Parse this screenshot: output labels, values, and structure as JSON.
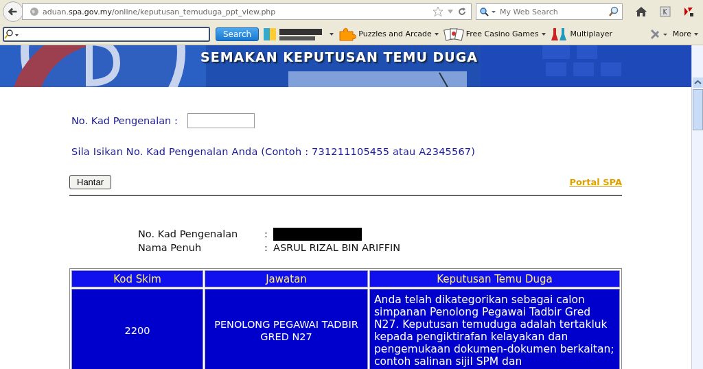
{
  "browser": {
    "address": {
      "host_prefix": "aduan.",
      "host_main": "spa.gov.my",
      "path": "/online/keputusan_temuduga_ppt_view.php"
    },
    "web_search": {
      "placeholder": "My Web Search"
    },
    "toolbar": {
      "search_button": "Search",
      "items": [
        {
          "label": "Puzzles and Arcade",
          "dropdown": true
        },
        {
          "label": "Free Casino Games",
          "dropdown": true
        },
        {
          "label": "Multiplayer",
          "dropdown": false
        }
      ],
      "more": "More"
    }
  },
  "banner": {
    "title": "SEMAKAN KEPUTUSAN TEMU DUGA"
  },
  "form": {
    "id_label": "No. Kad Pengenalan :",
    "hint": "Sila Isikan No. Kad Pengenalan Anda (Contoh : 731211105455 atau A2345567)",
    "submit": "Hantar",
    "portal_link": "Portal SPA"
  },
  "result": {
    "fields": [
      {
        "label": "No. Kad Pengenalan",
        "separator": ":",
        "redacted": true
      },
      {
        "label": "Nama Penuh",
        "separator": ":",
        "value": "ASRUL RIZAL BIN ARIFFIN",
        "redacted": false
      }
    ],
    "table": {
      "columns": [
        "Kod Skim",
        "Jawatan",
        "Keputusan Temu Duga"
      ],
      "rows": [
        {
          "cells": [
            "2200",
            "PENOLONG PEGAWAI TADBIR GRED N27",
            "Anda telah dikategorikan sebagai calon simpanan Penolong Pegawai Tadbir Gred N27. Keputusan temuduga adalah tertakluk kepada pengiktirafan kelayakan dan pengemukaan dokumen-dokumen berkaitan; contoh salinan sijil SPM dan"
          ]
        }
      ]
    }
  }
}
